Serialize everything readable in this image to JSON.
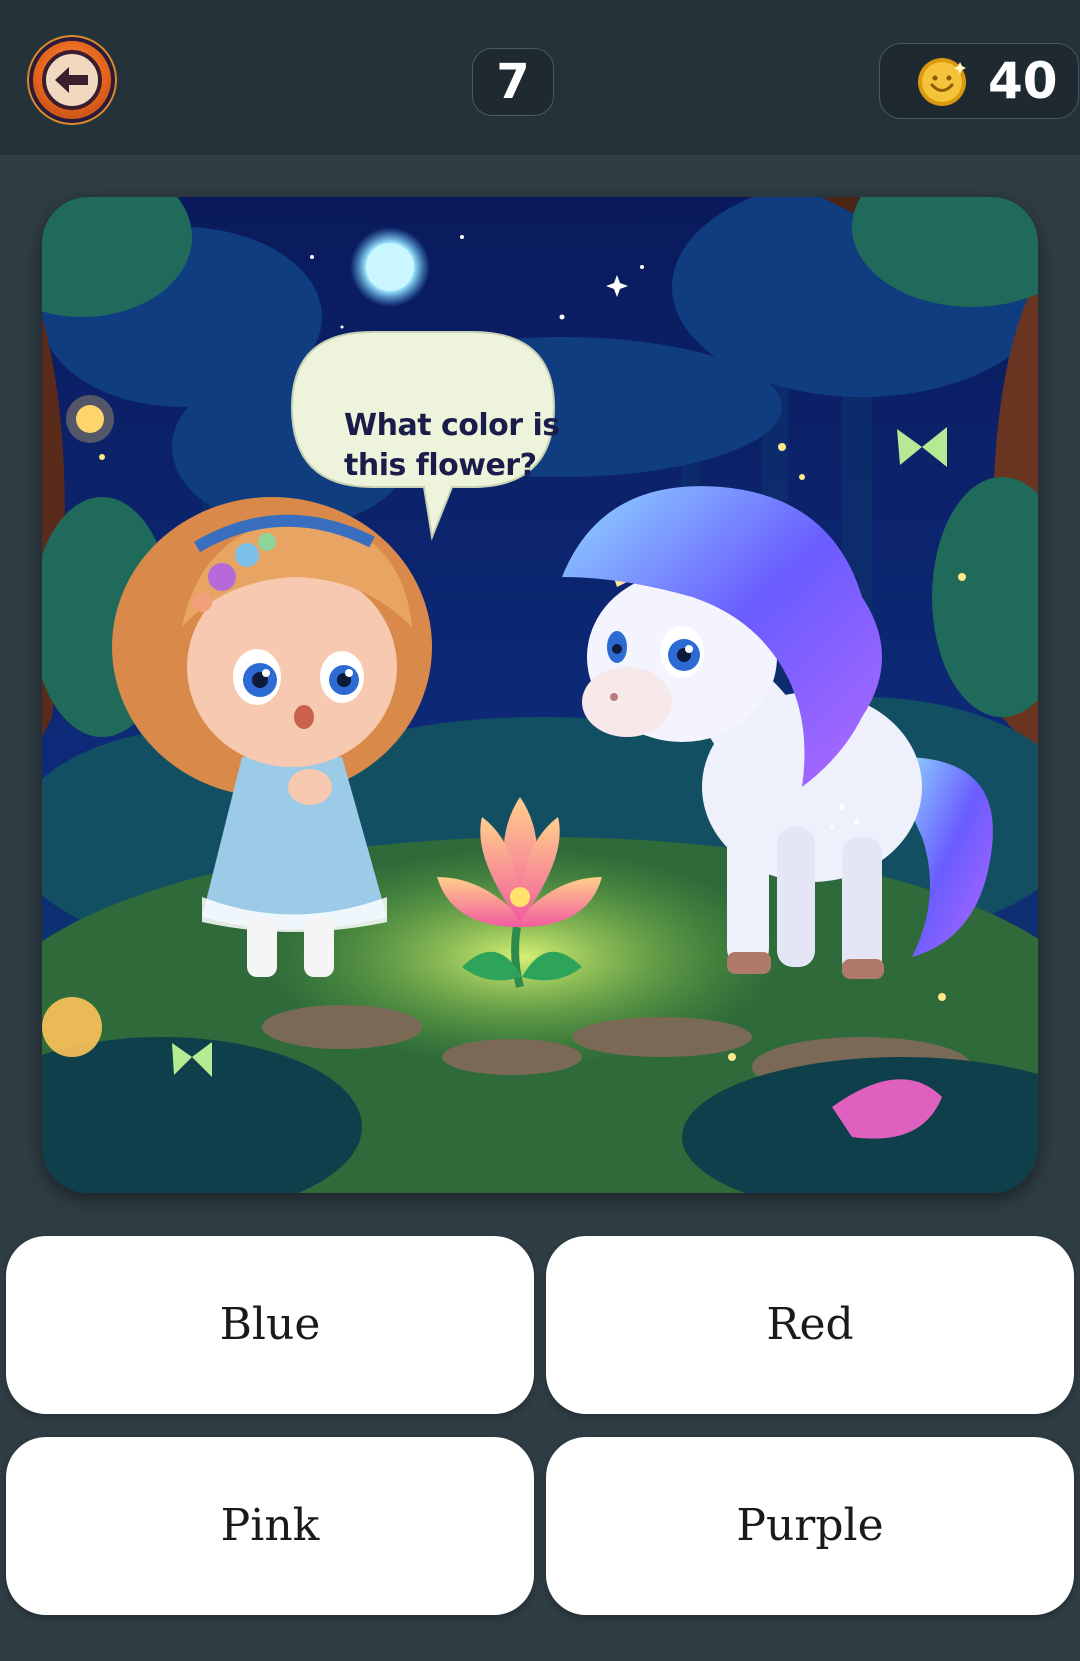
{
  "header": {
    "back_icon": "back-arrow-icon",
    "level": "7",
    "coins": {
      "icon": "smiley-coin-icon",
      "value": "40"
    }
  },
  "question": {
    "illustration": "Night forest scene: a girl and a unicorn looking at a glowing flower",
    "speech_bubble": [
      "What color is",
      "this flower?"
    ]
  },
  "answers": [
    {
      "label": "Blue"
    },
    {
      "label": "Red"
    },
    {
      "label": "Pink"
    },
    {
      "label": "Purple"
    }
  ],
  "colors": {
    "background": "#2f3d44",
    "topbar": "#26323a",
    "answer_bg": "#ffffff",
    "flower_pink": "#f48fb1"
  }
}
